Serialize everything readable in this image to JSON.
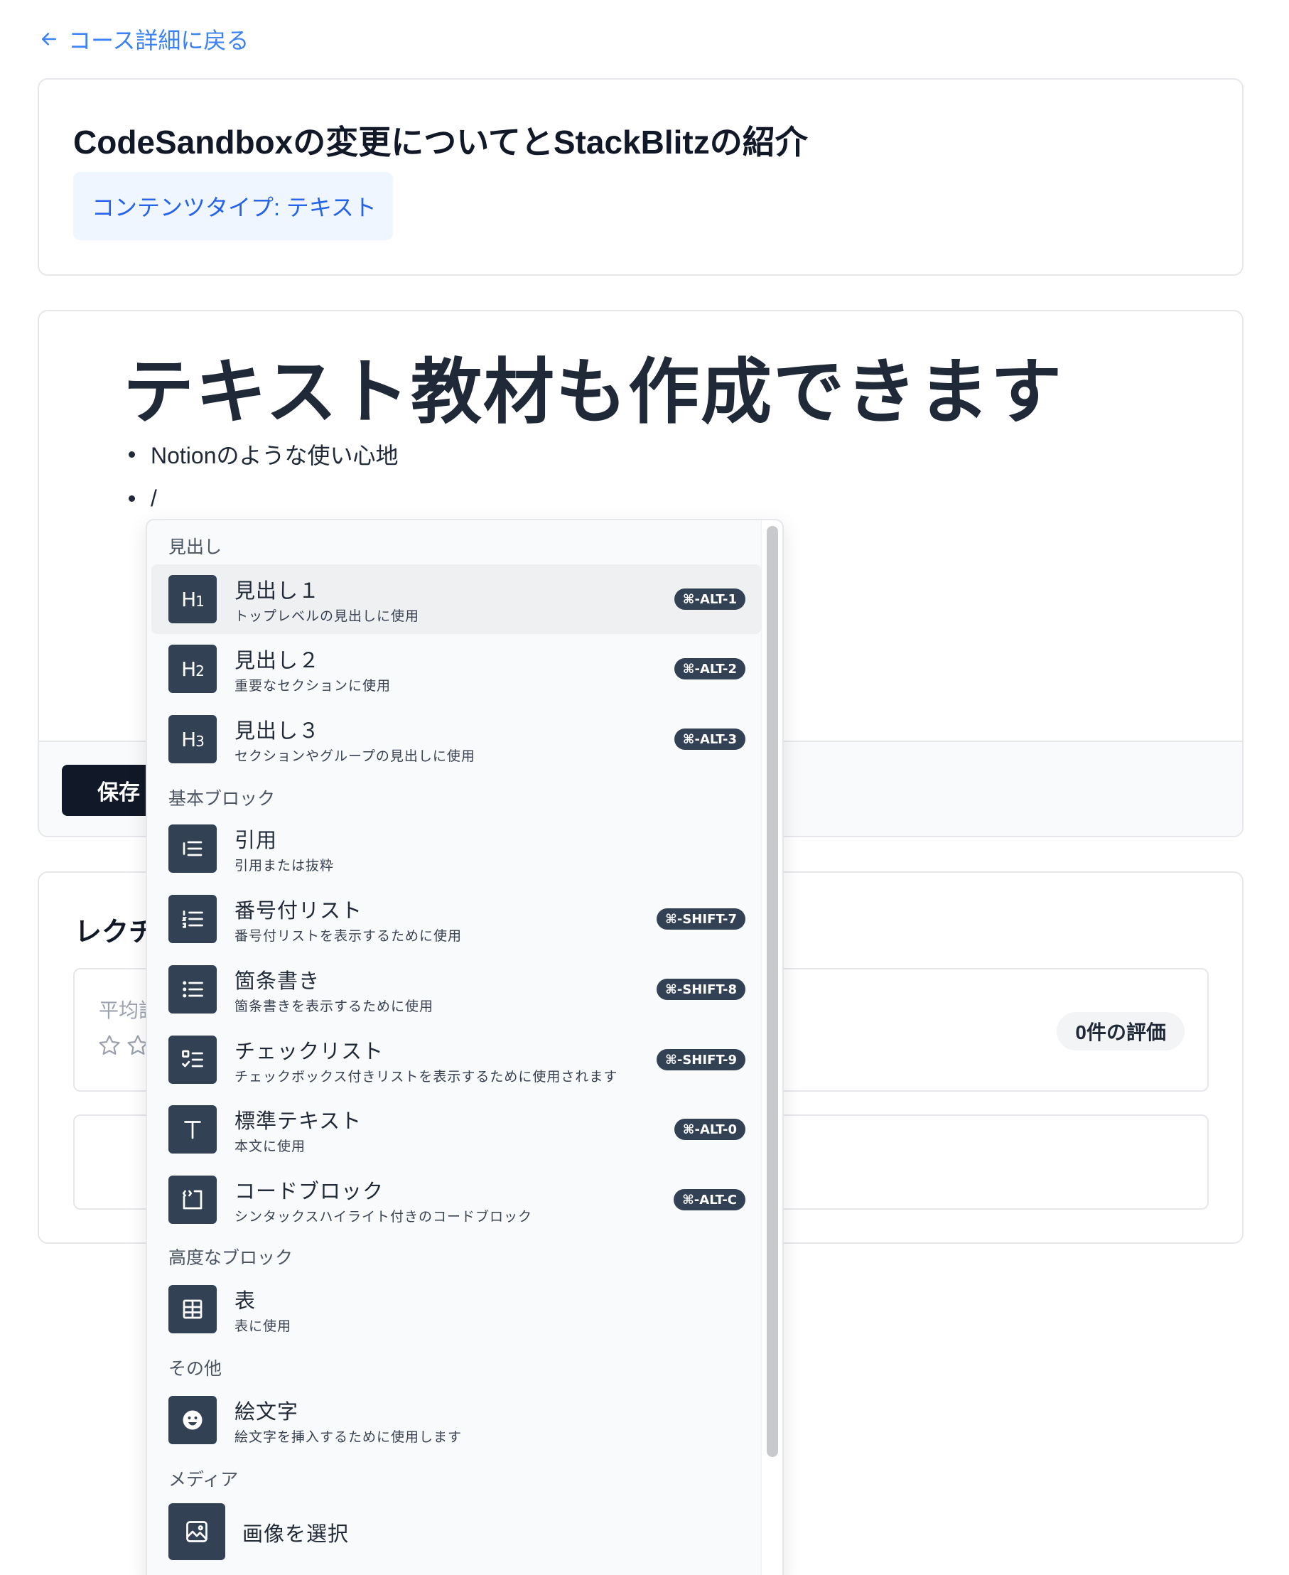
{
  "back_link": {
    "label": "コース詳細に戻る"
  },
  "lesson": {
    "title": "CodeSandboxの変更についてとStackBlitzの紹介",
    "content_type": "コンテンツタイプ: テキスト"
  },
  "editor": {
    "heading": "テキスト教材も作成できます",
    "bullets": [
      "Notionのような使い心地",
      "/"
    ],
    "save_label": "保存"
  },
  "review": {
    "title": "レクチ",
    "avg_label": "平均評",
    "rating_count": "0件の評価"
  },
  "slash_menu": {
    "sections": {
      "headings": "見出し",
      "basic": "基本ブロック",
      "advanced": "高度なブロック",
      "other": "その他",
      "media": "メディア"
    },
    "items": [
      {
        "icon": "heading-1-icon",
        "icon_text": "H1",
        "title": "見出し１",
        "desc": "トップレベルの見出しに使用",
        "shortcut": "⌘-ALT-1"
      },
      {
        "icon": "heading-2-icon",
        "icon_text": "H2",
        "title": "見出し２",
        "desc": "重要なセクションに使用",
        "shortcut": "⌘-ALT-2"
      },
      {
        "icon": "heading-3-icon",
        "icon_text": "H3",
        "title": "見出し３",
        "desc": "セクションやグループの見出しに使用",
        "shortcut": "⌘-ALT-3"
      },
      {
        "icon": "quote-icon",
        "title": "引用",
        "desc": "引用または抜粋",
        "shortcut": ""
      },
      {
        "icon": "numbered-list-icon",
        "title": "番号付リスト",
        "desc": "番号付リストを表示するために使用",
        "shortcut": "⌘-SHIFT-7"
      },
      {
        "icon": "bullet-list-icon",
        "title": "箇条書き",
        "desc": "箇条書きを表示するために使用",
        "shortcut": "⌘-SHIFT-8"
      },
      {
        "icon": "checklist-icon",
        "title": "チェックリスト",
        "desc": "チェックボックス付きリストを表示するために使用されます",
        "shortcut": "⌘-SHIFT-9"
      },
      {
        "icon": "text-icon",
        "title": "標準テキスト",
        "desc": "本文に使用",
        "shortcut": "⌘-ALT-0"
      },
      {
        "icon": "code-block-icon",
        "title": "コードブロック",
        "desc": "シンタックスハイライト付きのコードブロック",
        "shortcut": "⌘-ALT-C"
      },
      {
        "icon": "table-icon",
        "title": "表",
        "desc": "表に使用",
        "shortcut": ""
      },
      {
        "icon": "emoji-icon",
        "title": "絵文字",
        "desc": "絵文字を挿入するために使用します",
        "shortcut": ""
      },
      {
        "icon": "image-icon",
        "title": "画像を選択",
        "desc": "",
        "shortcut": ""
      }
    ]
  },
  "colors": {
    "link": "#3b82f6",
    "badge_bg": "#eff6ff",
    "icon_bg": "#334155",
    "save_bg": "#111827"
  }
}
